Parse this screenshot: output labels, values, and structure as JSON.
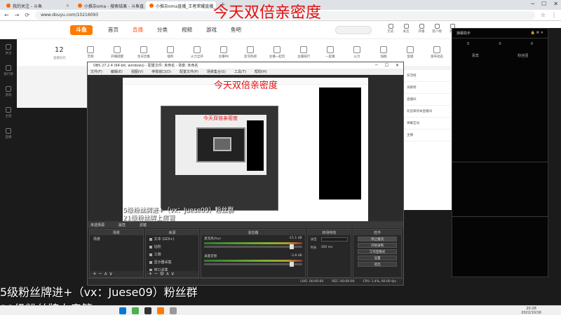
{
  "browser": {
    "tabs": [
      {
        "label": "我的关注 - 斗鱼",
        "active": false
      },
      {
        "label": "小推杂oma - 搜索结果 - 斗鱼直...",
        "active": false
      },
      {
        "label": "小推杂oma直播_王者荣耀直播_...",
        "active": true
      }
    ],
    "url": "www.douyu.com/10216093"
  },
  "site": {
    "logo": "斗鱼",
    "nav": [
      "首页",
      "直播",
      "分类",
      "视频",
      "游戏",
      "鱼吧"
    ],
    "active_nav": "直播",
    "header_icons": [
      "历史",
      "关注",
      "开播",
      "客户端",
      "消息"
    ],
    "categories": [
      "直播日历",
      "音频",
      "开播提醒",
      "生日合集",
      "福利",
      "火力全开",
      "主播PK",
      "友邻热榜",
      "主播一起玩",
      "主播排行",
      "一起看",
      "火力",
      "加群",
      "鱼塘",
      "发布动态"
    ],
    "count": "12",
    "count_sub": "直播日历"
  },
  "sidebar": [
    "关注",
    "排行榜",
    "游戏",
    "主题",
    "直播"
  ],
  "right_panel": {
    "title": "弹幕助手",
    "stats": [
      "0",
      "0",
      "0"
    ],
    "tabs": [
      "贵宾",
      "粉丝团"
    ]
  },
  "chat": {
    "lines": [
      "日活榜",
      "贡献榜",
      "直播间",
      "欢迎来到本直播间",
      "弹幕互动",
      "主播"
    ]
  },
  "obs": {
    "title": "OBS 27.2.4 (64-bit, windows) - 配置文件: 未命名 - 场景: 未命名",
    "menu": [
      "文件(F)",
      "编辑(E)",
      "视图(V)",
      "停靠窗口(D)",
      "配置文件(P)",
      "场景集合(S)",
      "工具(T)",
      "帮助(H)"
    ],
    "preview_bar": [
      "未选择源",
      "属性",
      "滤镜"
    ],
    "docks": {
      "scenes": {
        "title": "场景",
        "items": [
          "场景"
        ]
      },
      "sources": {
        "title": "来源",
        "items": [
          "文本 (GDI+)",
          "钻粉",
          "工牌",
          "显示器采集",
          "窗口采集"
        ]
      },
      "mixer": {
        "title": "混音器",
        "channels": [
          {
            "name": "麦克风/Aux",
            "db": "-15.1 dB"
          },
          {
            "name": "桌面音频",
            "db": "-3.8 dB"
          }
        ]
      },
      "transitions": {
        "title": "转场特效",
        "labels": [
          "淡出",
          "时长",
          "300 ms"
        ]
      },
      "controls": {
        "title": "控件",
        "buttons": [
          "停止推流",
          "开始录制",
          "工作室模式",
          "设置",
          "退出"
        ]
      }
    },
    "status": [
      "LIVE: 00:00:00",
      "REC: 00:00:00",
      "CPU: 1.4%, 60.00 fps"
    ],
    "nested_title": "OBS 27.2.4"
  },
  "overlays": {
    "top": "今天双倍亲密度",
    "bottom1": "5级粉丝牌进+（vx：Juese09）粉丝群",
    "bottom2": "21级粉丝牌上房管"
  },
  "taskbar": {
    "time": "20:28",
    "date": "2022/10/16"
  },
  "colors": {
    "brand": "#ff7a00",
    "accent_red": "#e01010",
    "active_nav": "#ff5d23"
  }
}
